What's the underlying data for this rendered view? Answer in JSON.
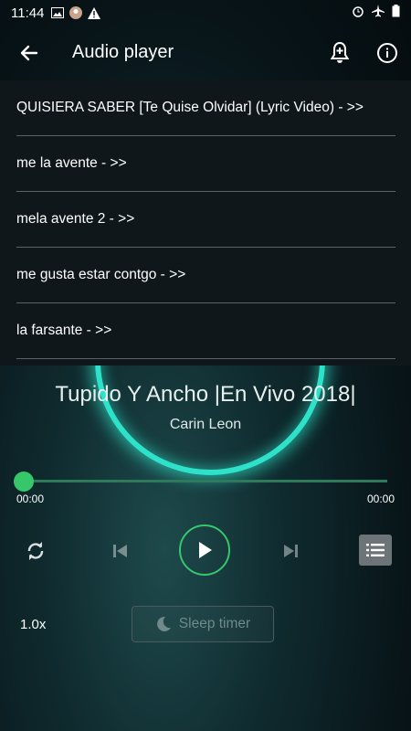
{
  "status": {
    "time": "11:44"
  },
  "appbar": {
    "title": "Audio player",
    "back_icon": "arrow-left-icon",
    "bell_icon": "alarm-bell-icon",
    "info_icon": "info-icon"
  },
  "playlist": {
    "items": [
      {
        "label": "QUISIERA SABER [Te Quise Olvidar] (Lyric Video) - >>"
      },
      {
        "label": "me la avente - >>"
      },
      {
        "label": "mela avente 2 - >>"
      },
      {
        "label": "me gusta estar contgo - >>"
      },
      {
        "label": "la farsante - >>"
      }
    ]
  },
  "now_playing": {
    "title": "Tupido Y Ancho |En Vivo 2018|",
    "artist": "Carin Leon",
    "position": "00:00",
    "duration": "00:00",
    "progress": 0
  },
  "controls": {
    "speed": "1.0x",
    "sleep_timer": "Sleep timer"
  },
  "colors": {
    "accent": "#35c76a",
    "ring": "#2de2c8",
    "panel": "#0f171b"
  }
}
